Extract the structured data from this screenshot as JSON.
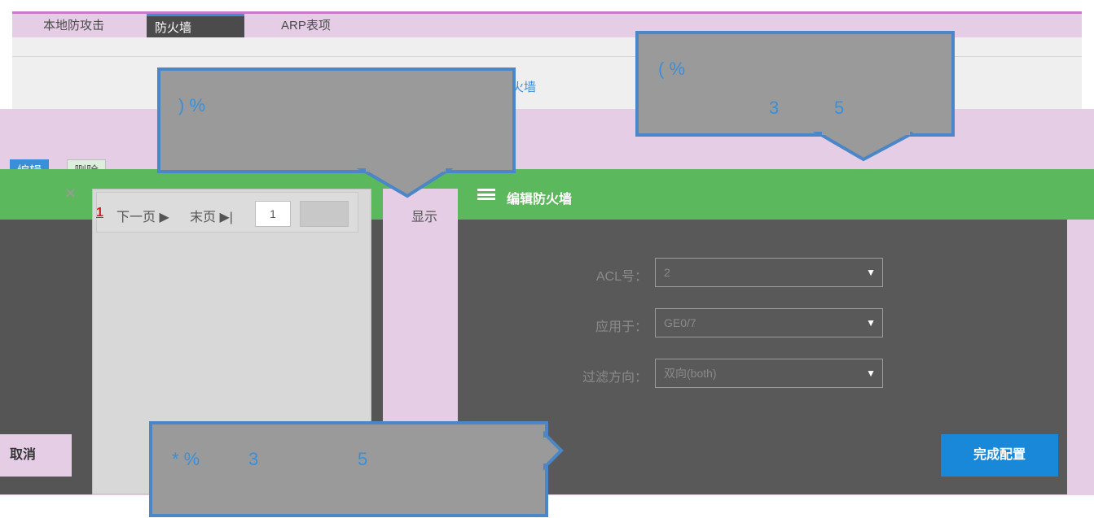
{
  "tabs": {
    "local": "本地防攻击",
    "firewall": "防火墙",
    "arp": "ARP表项"
  },
  "header": {
    "fw_link": "火墙"
  },
  "toolbar": {
    "edit": "编辑",
    "delete": "删除"
  },
  "pager": {
    "current": "1",
    "next": "下一页 ▶",
    "last": "末页 ▶|",
    "page_input": "1"
  },
  "show_label": "显示",
  "dialog": {
    "title": "编辑防火墙",
    "fields": [
      {
        "label": "ACL号：",
        "value": "2"
      },
      {
        "label": "应用于：",
        "value": "GE0/7"
      },
      {
        "label": "过滤方向：",
        "value": "双向(both)"
      }
    ],
    "finish": "完成配置",
    "cancel": "取消"
  },
  "callouts": {
    "c1": ") %",
    "c2_a": "( %",
    "c2_b": "3",
    "c2_c": "5",
    "c3_a": "* %",
    "c3_b": "3",
    "c3_c": "5"
  },
  "colors": {
    "accent": "#3a8fd8",
    "green": "#5cb85c",
    "dialog_bg": "#595959",
    "pink": "#e6cde6"
  }
}
